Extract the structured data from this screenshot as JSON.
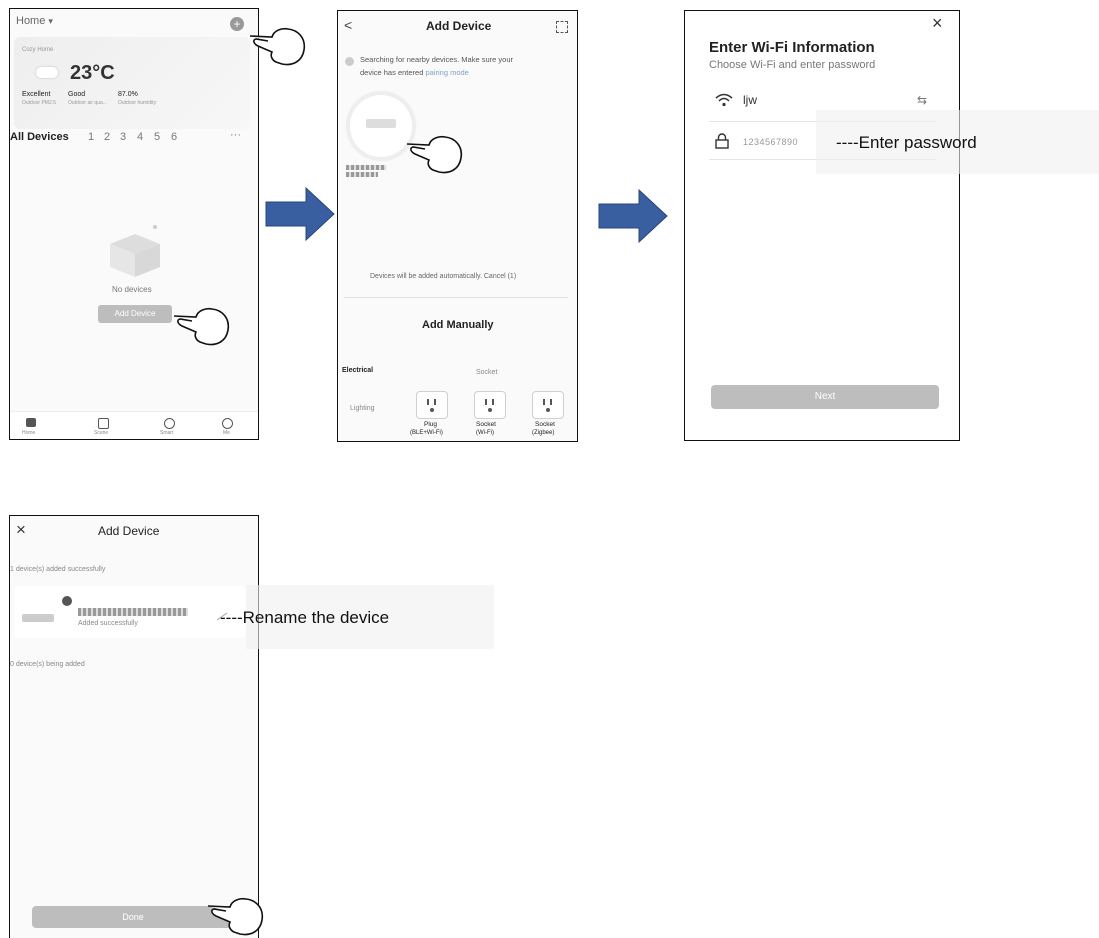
{
  "panel1": {
    "home_label": "Home",
    "home_caret": "▾",
    "add_icon": "plus-circle-icon",
    "weather_location": "Cozy Home",
    "temperature": "23°C",
    "stats": [
      {
        "value": "Excellent",
        "label": "Outdoor PM2.5"
      },
      {
        "value": "Good",
        "label": "Outdoor air qua..."
      },
      {
        "value": "87.0%",
        "label": "Outdoor humidity"
      }
    ],
    "tabs": [
      "All Devices",
      "1",
      "2",
      "3",
      "4",
      "5",
      "6"
    ],
    "more": "···",
    "empty_text": "No devices",
    "add_device_button": "Add Device",
    "nav": [
      "Home",
      "Scene",
      "Smart",
      "Me"
    ]
  },
  "panel2": {
    "back": "<",
    "title": "Add Device",
    "searching_text": "Searching for nearby devices. Make sure your",
    "searching_text2": "device has entered",
    "pairing_link": "pairing mode",
    "devices_auto_text": "Devices will be added automatically. Cancel (1)",
    "add_manually": "Add Manually",
    "category_electrical": "Electrical",
    "category_lighting": "Lighting",
    "section_socket": "Socket",
    "devices": [
      {
        "name": "Plug",
        "sub": "(BLE+Wi-Fi)"
      },
      {
        "name": "Socket",
        "sub": "(Wi-Fi)"
      },
      {
        "name": "Socket",
        "sub": "(Zigbee)"
      }
    ]
  },
  "panel3": {
    "close": "×",
    "title": "Enter Wi-Fi Information",
    "subtitle": "Choose Wi-Fi and enter password",
    "ssid": "ljw",
    "password": "1234567890",
    "next_button": "Next",
    "callout": "----Enter password"
  },
  "panel4": {
    "close": "×",
    "title": "Add Device",
    "success_count": "1 device(s) added successfully",
    "added_status": "Added successfully",
    "adding_count": "0 device(s) being added",
    "done_button": "Done",
    "callout": "----Rename the device"
  },
  "colors": {
    "arrow": "#3a5fa0",
    "button": "#bdbdbd",
    "link": "#7fa0c8"
  }
}
